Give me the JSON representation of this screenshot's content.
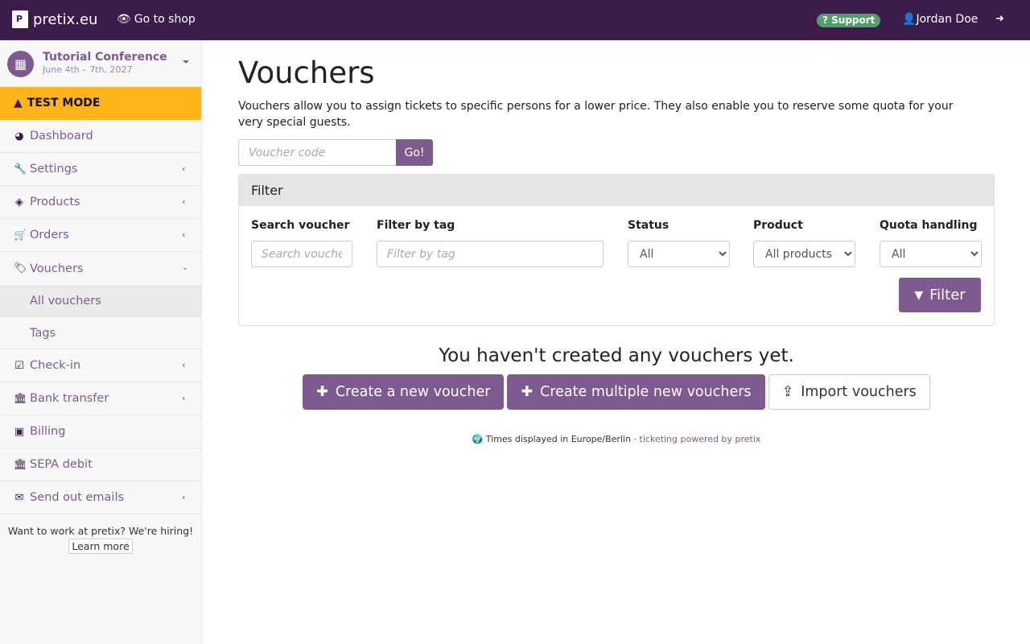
{
  "topbar": {
    "brand": "pretix.eu",
    "goto_shop": "Go to shop",
    "support": "Support",
    "user": "Jordan Doe"
  },
  "sidebar": {
    "event": {
      "name": "Tutorial Conference",
      "date": "June 4th – 7th, 2027"
    },
    "test_mode": "TEST MODE",
    "items": [
      {
        "label": "Dashboard",
        "icon": "dashboard-icon",
        "has_children": false
      },
      {
        "label": "Settings",
        "icon": "wrench-icon",
        "has_children": true
      },
      {
        "label": "Products",
        "icon": "ticket-icon",
        "has_children": true
      },
      {
        "label": "Orders",
        "icon": "cart-icon",
        "has_children": true
      },
      {
        "label": "Vouchers",
        "icon": "tags-icon",
        "has_children": true,
        "expanded": true,
        "children": [
          {
            "label": "All vouchers",
            "active": true
          },
          {
            "label": "Tags"
          }
        ]
      },
      {
        "label": "Check-in",
        "icon": "check-square-icon",
        "has_children": true
      },
      {
        "label": "Bank transfer",
        "icon": "bank-icon",
        "has_children": true
      },
      {
        "label": "Billing",
        "icon": "money-icon",
        "has_children": false
      },
      {
        "label": "SEPA debit",
        "icon": "bank-icon",
        "has_children": false
      },
      {
        "label": "Send out emails",
        "icon": "envelope-icon",
        "has_children": true
      }
    ],
    "hiring_text": "Want to work at pretix? We're hiring!",
    "learn_more": "Learn more"
  },
  "main": {
    "title": "Vouchers",
    "description": "Vouchers allow you to assign tickets to specific persons for a lower price. They also enable you to reserve some quota for your very special guests.",
    "voucher_lookup": {
      "placeholder": "Voucher code",
      "button": "Go!"
    },
    "filter": {
      "heading": "Filter",
      "search": {
        "label": "Search voucher",
        "placeholder": "Search voucher"
      },
      "tag": {
        "label": "Filter by tag",
        "placeholder": "Filter by tag"
      },
      "status": {
        "label": "Status",
        "value": "All"
      },
      "product": {
        "label": "Product",
        "value": "All products"
      },
      "quota": {
        "label": "Quota handling",
        "value": "All"
      },
      "button": "Filter"
    },
    "empty_message": "You haven't created any vouchers yet.",
    "actions": {
      "create": "Create a new voucher",
      "create_multiple": "Create multiple new vouchers",
      "import": "Import vouchers"
    },
    "footer": {
      "timezone": "Times displayed in Europe/Berlin",
      "separator": " · ",
      "powered": "ticketing powered by pretix"
    }
  },
  "colors": {
    "brand_dark": "#3b1c4a",
    "primary": "#7f5a91",
    "test_mode": "#ffb419",
    "support": "#50a167"
  }
}
